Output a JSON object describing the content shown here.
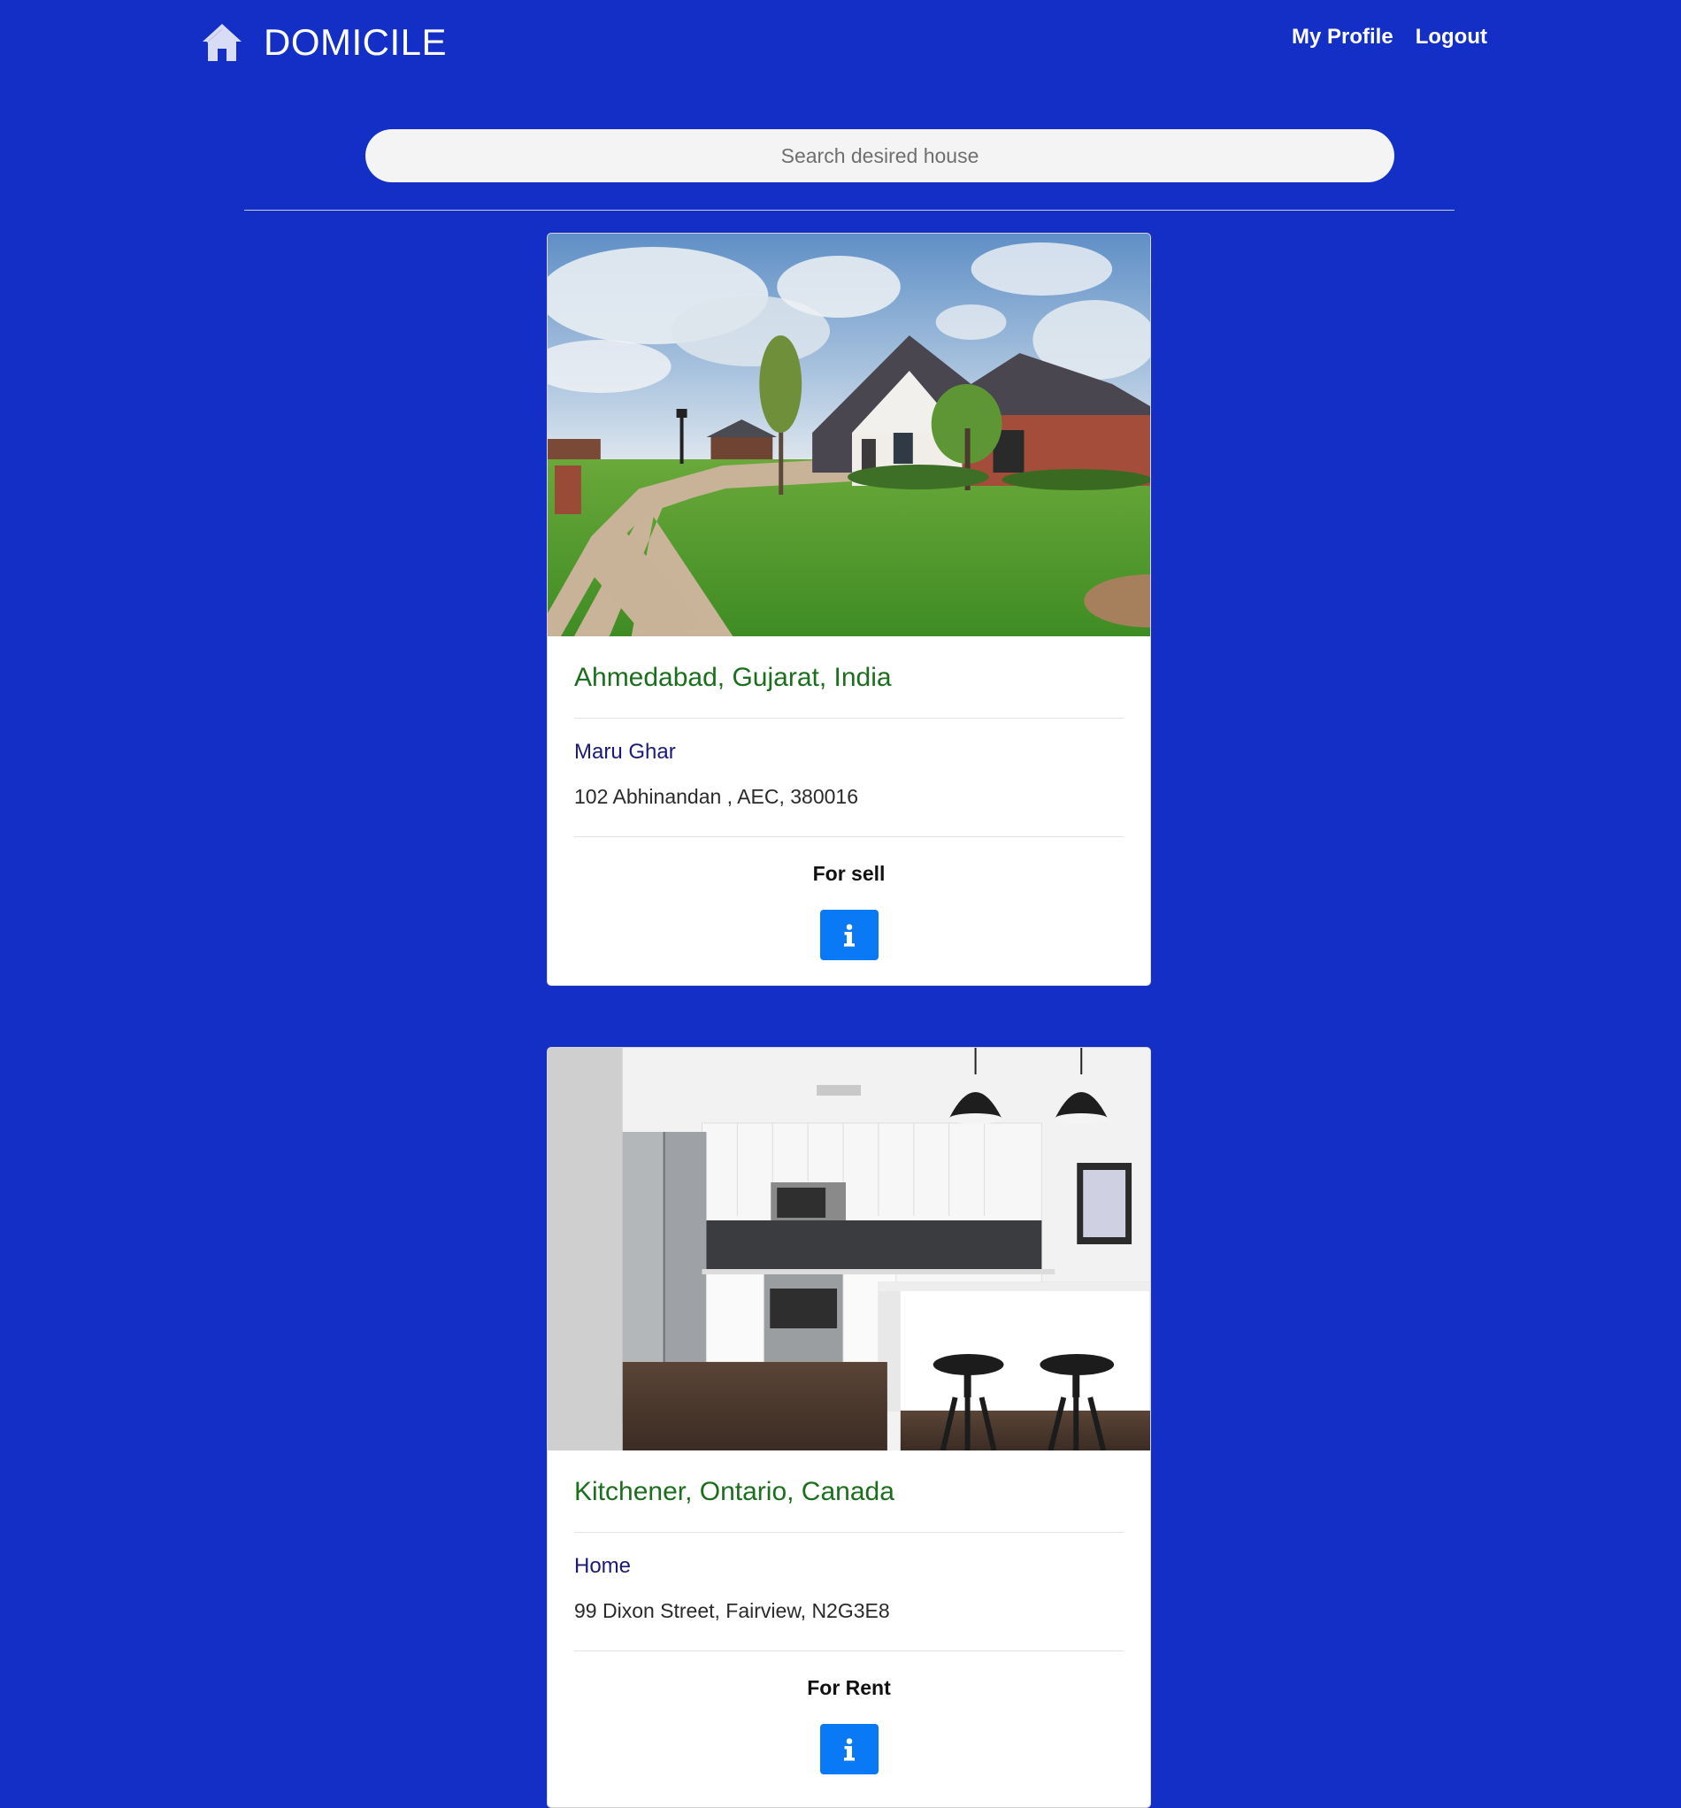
{
  "header": {
    "brand": "DOMICILE",
    "brand_icon": "home-icon",
    "nav": {
      "profile": "My Profile",
      "logout": "Logout"
    }
  },
  "search": {
    "placeholder": "Search desired house",
    "value": ""
  },
  "listings": [
    {
      "location": "Ahmedabad, Gujarat, India",
      "name": "Maru Ghar",
      "address": "102 Abhinandan , AEC, 380016",
      "status": "For sell",
      "image": "house-exterior-photo",
      "action_icon": "info-icon"
    },
    {
      "location": "Kitchener, Ontario, Canada",
      "name": "Home",
      "address": "99 Dixon Street, Fairview, N2G3E8",
      "status": "For Rent",
      "image": "kitchen-interior-photo",
      "action_icon": "info-icon"
    }
  ],
  "colors": {
    "background": "#132fc6",
    "location_text": "#1b6f1c",
    "name_text": "#1a1a7a",
    "info_button": "#0a79f5"
  }
}
